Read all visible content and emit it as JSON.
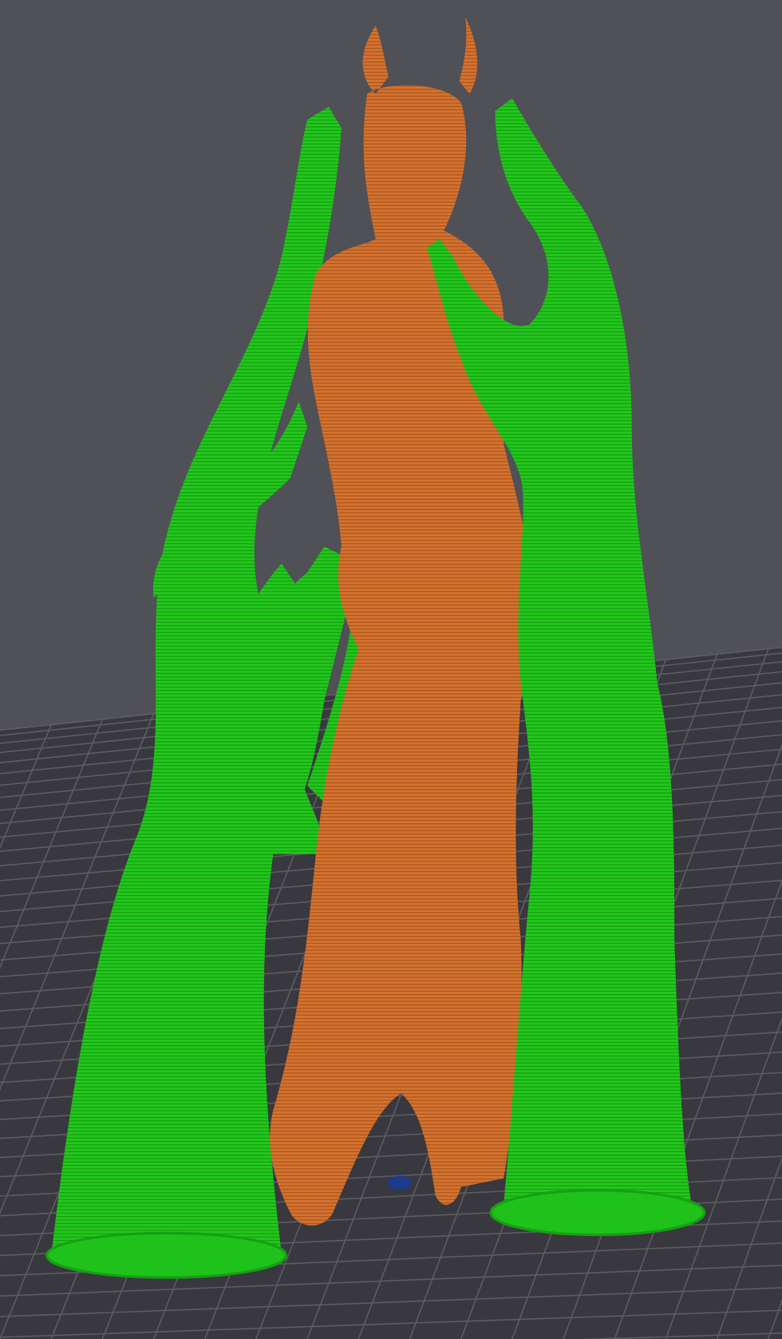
{
  "viewport": {
    "background_color": "#505057",
    "bed_color": "#38383e",
    "grid_color": "#5c5c63",
    "support_color": "#1fc21a",
    "support_shade": "#17a013",
    "model_color": "#d0702c",
    "model_shade": "#b55c20"
  }
}
